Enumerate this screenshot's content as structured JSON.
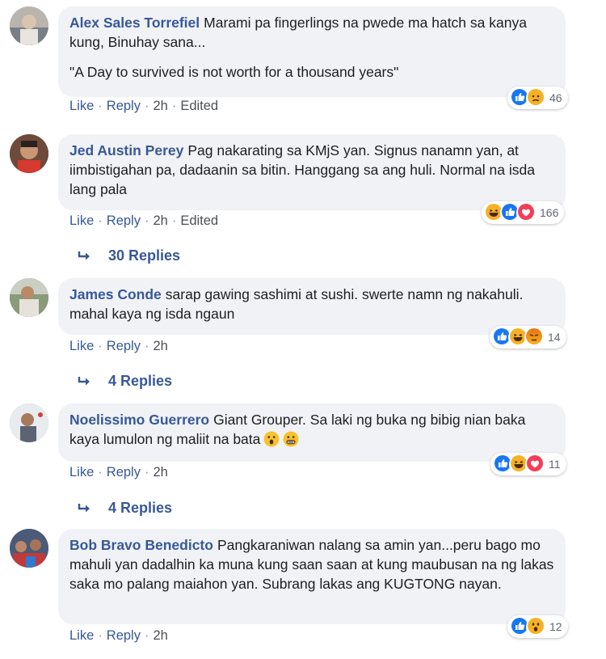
{
  "action_labels": {
    "like": "Like",
    "reply": "Reply",
    "separator": "·"
  },
  "comments": [
    {
      "author": "Alex Sales Torrefiel",
      "text_line1": "Marami pa fingerlings na pwede ma hatch sa kanya kung, Binuhay sana...",
      "text_line2": "\"A Day to survived is not worth for a thousand years\"",
      "time": "2h",
      "edited": "Edited",
      "reactions": {
        "count": "46",
        "icons": [
          "like",
          "sad"
        ]
      }
    },
    {
      "author": "Jed Austin Perey",
      "text": "Pag nakarating sa KMjS yan. Signus nanamn yan, at iimbistigahan pa, dadaanin sa bitin. Hanggang sa ang huli. Normal na isda lang pala",
      "time": "2h",
      "edited": "Edited",
      "reactions": {
        "count": "166",
        "icons": [
          "haha",
          "like",
          "love"
        ]
      },
      "replies": "30 Replies"
    },
    {
      "author": "James Conde",
      "text": "sarap gawing sashimi at sushi. swerte namn ng nakahuli. mahal kaya ng isda ngaun",
      "time": "2h",
      "reactions": {
        "count": "14",
        "icons": [
          "like",
          "haha",
          "angry"
        ]
      },
      "replies": "4 Replies"
    },
    {
      "author": "Noelissimo Guerrero",
      "text": "Giant Grouper. Sa laki ng buka ng bibig nian baka kaya lumulon ng maliit na bata",
      "time": "2h",
      "reactions": {
        "count": "11",
        "icons": [
          "like",
          "haha",
          "love"
        ]
      },
      "replies": "4 Replies"
    },
    {
      "author": "Bob Bravo Benedicto",
      "text": "Pangkaraniwan nalang sa amin yan...peru bago mo mahuli yan dadalhin ka muna kung saan saan at kung maubusan na ng lakas saka mo palang maiahon yan. Subrang lakas ang KUGTONG nayan.",
      "time": "2h",
      "reactions": {
        "count": "12",
        "icons": [
          "like",
          "wow"
        ]
      }
    }
  ]
}
